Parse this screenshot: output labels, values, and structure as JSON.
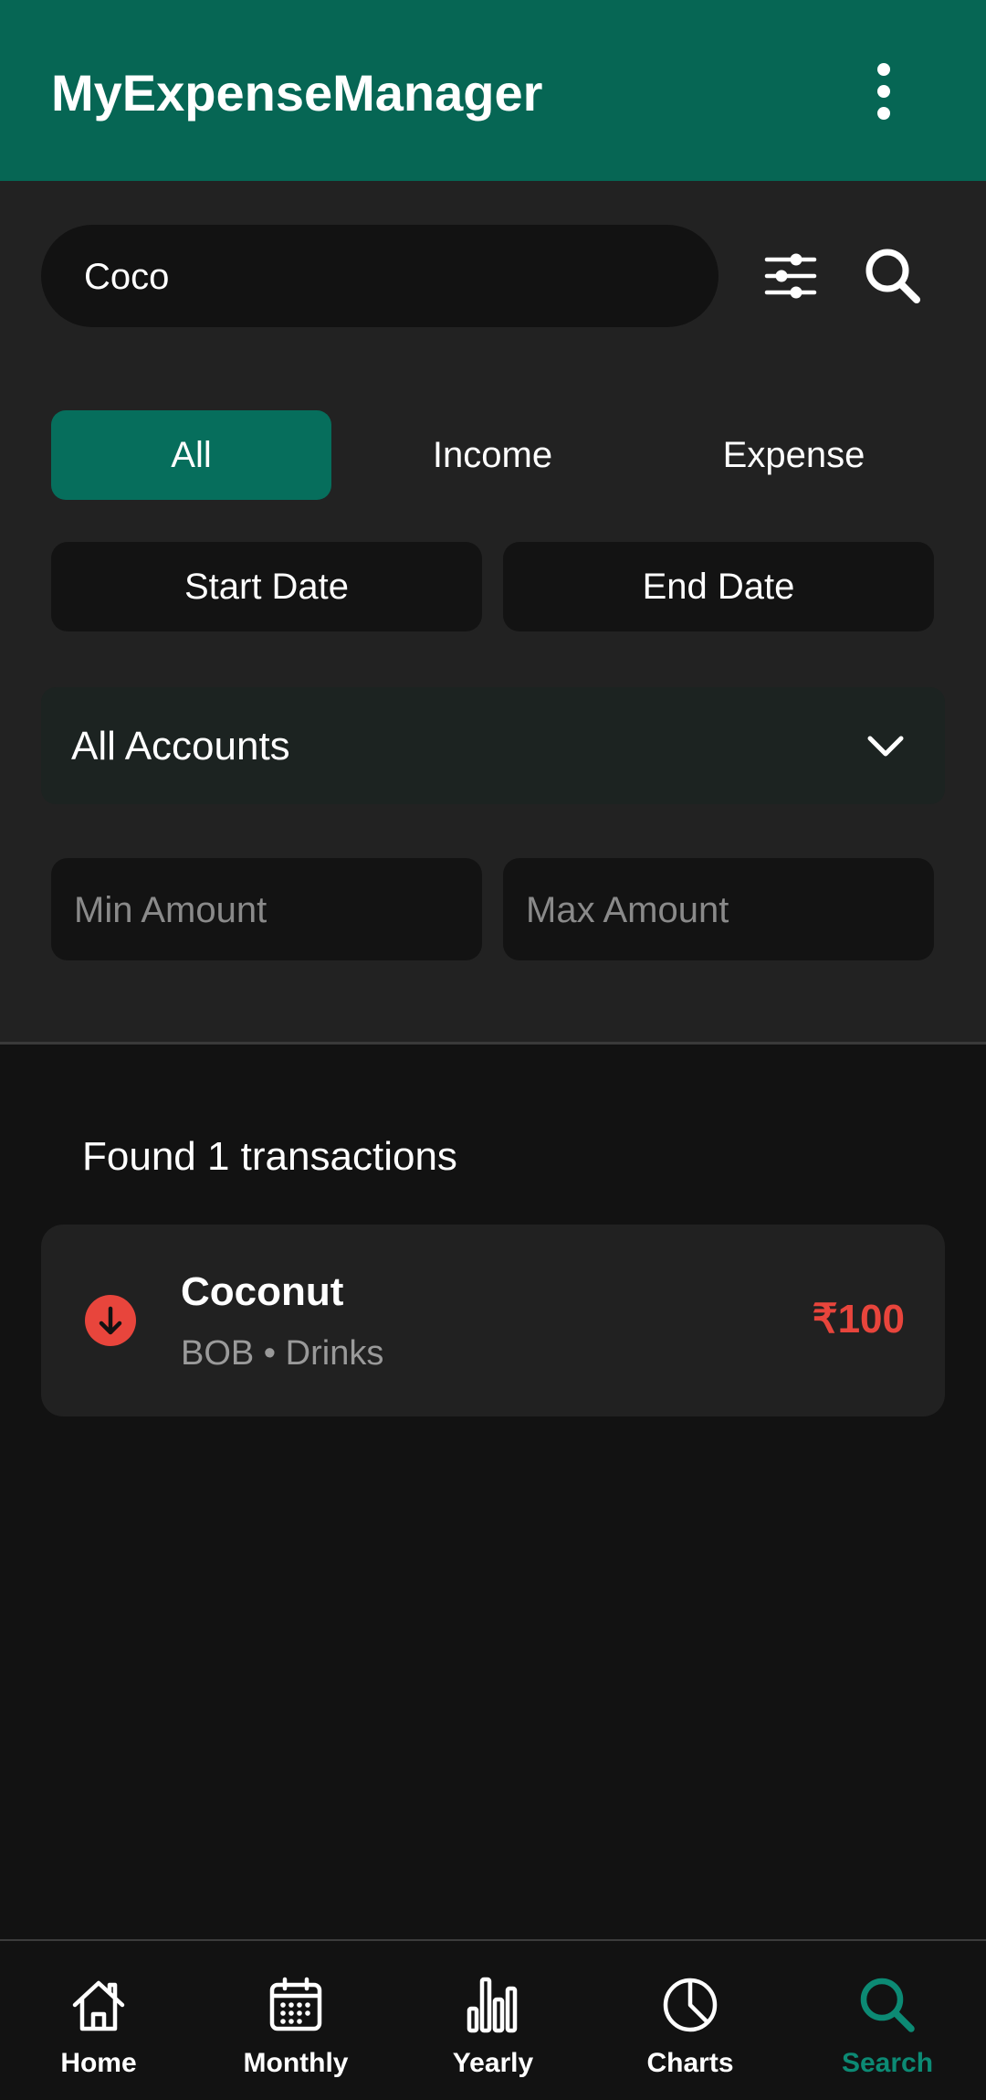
{
  "app": {
    "title": "MyExpenseManager"
  },
  "search": {
    "value": "Coco"
  },
  "type_filter": {
    "options": [
      "All",
      "Income",
      "Expense"
    ],
    "selected": "All"
  },
  "dates": {
    "start_label": "Start Date",
    "end_label": "End Date"
  },
  "account": {
    "selected": "All Accounts"
  },
  "amount": {
    "min_placeholder": "Min Amount",
    "max_placeholder": "Max Amount"
  },
  "results": {
    "summary": "Found 1 transactions",
    "items": [
      {
        "title": "Coconut",
        "subtitle": "BOB • Drinks",
        "amount": "₹100",
        "type": "expense"
      }
    ]
  },
  "nav": {
    "items": [
      {
        "label": "Home",
        "icon": "home-icon"
      },
      {
        "label": "Monthly",
        "icon": "calendar-icon"
      },
      {
        "label": "Yearly",
        "icon": "bar-chart-icon"
      },
      {
        "label": "Charts",
        "icon": "pie-chart-icon"
      },
      {
        "label": "Search",
        "icon": "search-icon"
      }
    ],
    "active": "Search"
  },
  "colors": {
    "primary": "#066654",
    "accent": "#0c8a74",
    "expense": "#e8453c",
    "surface": "#222222",
    "background": "#121212"
  }
}
